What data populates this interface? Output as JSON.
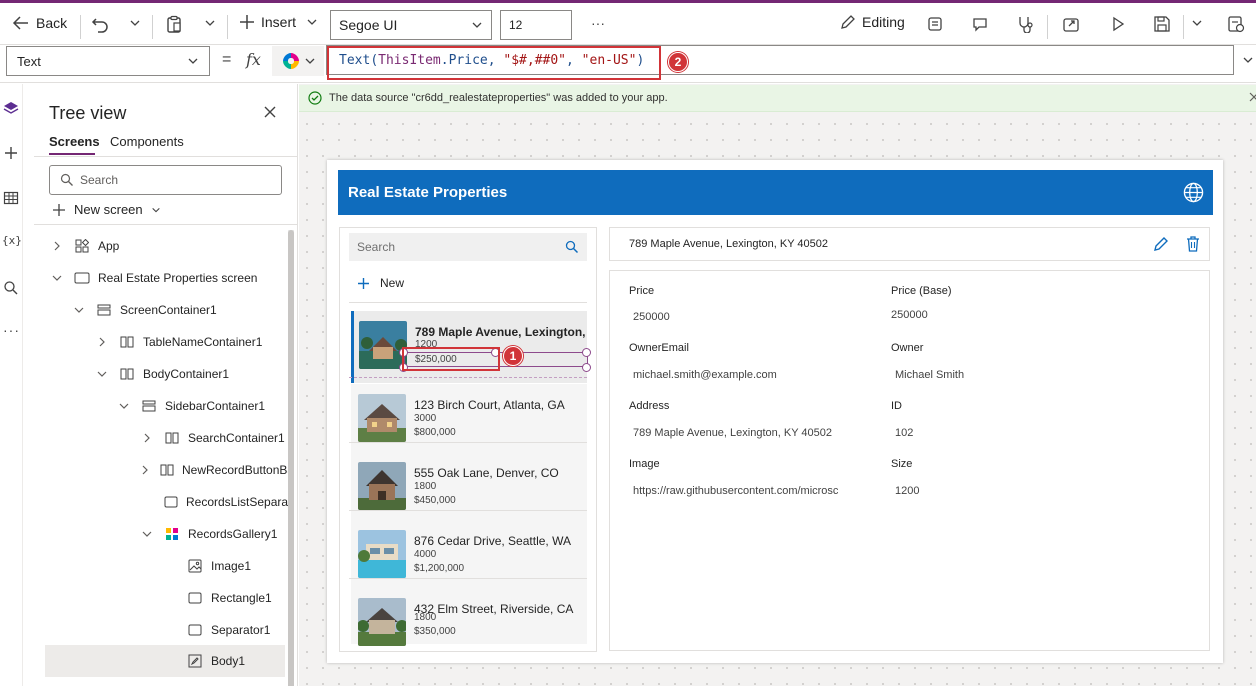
{
  "toolbar": {
    "back_label": "Back",
    "insert_label": "Insert",
    "font_value": "Segoe UI",
    "font_size_value": "12",
    "more_label": "···",
    "editing_label": "Editing"
  },
  "formula_bar": {
    "property_value": "Text",
    "equals_label": "=",
    "fx_label": "fx",
    "formula": {
      "fn": "Text",
      "open": "(",
      "control": "ThisItem",
      "dot": ".",
      "field": "Price",
      "sep1": ", ",
      "format": "\"$#,##0\"",
      "sep2": ", ",
      "locale": "\"en-US\"",
      "close": ")"
    },
    "callout_number": "2"
  },
  "tree_view": {
    "title": "Tree view",
    "tabs": [
      "Screens",
      "Components"
    ],
    "search_placeholder": "Search",
    "new_screen_label": "New screen",
    "items": [
      {
        "label": "App"
      },
      {
        "label": "Real Estate Properties screen"
      },
      {
        "label": "ScreenContainer1"
      },
      {
        "label": "TableNameContainer1"
      },
      {
        "label": "BodyContainer1"
      },
      {
        "label": "SidebarContainer1"
      },
      {
        "label": "SearchContainer1"
      },
      {
        "label": "NewRecordButtonBa"
      },
      {
        "label": "RecordsListSeparato"
      },
      {
        "label": "RecordsGallery1"
      },
      {
        "label": "Image1"
      },
      {
        "label": "Rectangle1"
      },
      {
        "label": "Separator1"
      },
      {
        "label": "Body1"
      }
    ]
  },
  "notification": {
    "text": "The data source \"cr6dd_realestateproperties\" was added to your app."
  },
  "app": {
    "header_title": "Real Estate Properties",
    "search_placeholder": "Search",
    "new_label": "New",
    "gallery": [
      {
        "title": "789 Maple Avenue, Lexington,",
        "size": "1200",
        "price": "$250,000"
      },
      {
        "title": "123 Birch Court, Atlanta, GA",
        "size": "3000",
        "price": "$800,000"
      },
      {
        "title": "555 Oak Lane, Denver, CO",
        "size": "1800",
        "price": "$450,000"
      },
      {
        "title": "876 Cedar Drive, Seattle, WA",
        "size": "4000",
        "price": "$1,200,000"
      },
      {
        "title": "432 Elm Street, Riverside, CA",
        "size": "1800",
        "price": "$350,000"
      }
    ],
    "callout_number": "1",
    "detail_title": "789 Maple Avenue, Lexington, KY 40502",
    "fields": {
      "price_label": "Price",
      "price_value": "250000",
      "price_base_label": "Price (Base)",
      "price_base_value": "250000",
      "owner_email_label": "OwnerEmail",
      "owner_email_value": "michael.smith@example.com",
      "owner_label": "Owner",
      "owner_value": "Michael Smith",
      "address_label": "Address",
      "address_value": "789 Maple Avenue, Lexington, KY 40502",
      "id_label": "ID",
      "id_value": "102",
      "image_label": "Image",
      "image_value": "https://raw.githubusercontent.com/microsc",
      "size_label": "Size",
      "size_value": "1200"
    }
  }
}
